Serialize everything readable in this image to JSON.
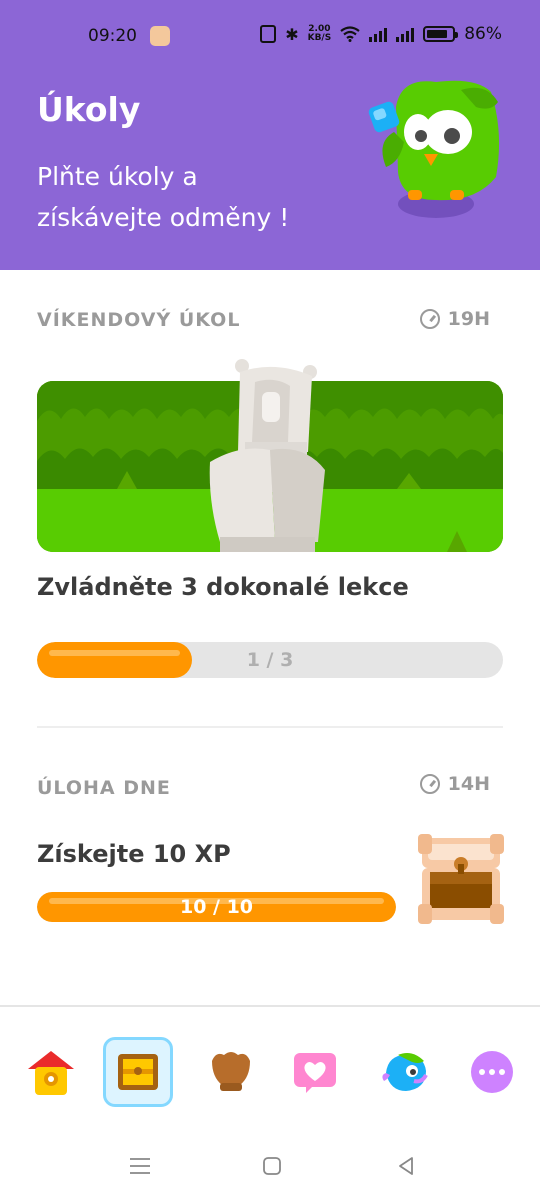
{
  "status_bar": {
    "time": "09:20",
    "network_speed": "2.00",
    "network_speed_unit": "KB/S",
    "battery": "86%"
  },
  "header": {
    "title": "Úkoly",
    "subtitle": "Plňte úkoly a získávejte odměny !",
    "background": "#8c66d6"
  },
  "weekend_quest": {
    "label": "VÍKENDOVÝ ÚKOL",
    "timer": "19H",
    "title": "Zvládněte 3 dokonalé lekce",
    "progress_text": "1 / 3",
    "progress": 0.3333
  },
  "daily_quest": {
    "label": "ÚLOHA DNE",
    "timer": "14H",
    "title": "Získejte 10 XP",
    "progress_text": "10 / 10",
    "progress": 1.0
  },
  "bottom_nav": {
    "items": [
      {
        "icon": "home-icon",
        "active": false
      },
      {
        "icon": "quests-chest-icon",
        "active": true
      },
      {
        "icon": "leagues-shield-icon",
        "active": false
      },
      {
        "icon": "hearts-icon",
        "active": false
      },
      {
        "icon": "duolingo-bird-icon",
        "active": false
      },
      {
        "icon": "more-icon",
        "active": false
      }
    ]
  },
  "colors": {
    "accent_orange": "#ff9600",
    "track_gray": "#e5e5e5",
    "label_gray": "#9a9a9a",
    "text_dark": "#3c3c3c",
    "active_nav_border": "#84d8ff"
  }
}
